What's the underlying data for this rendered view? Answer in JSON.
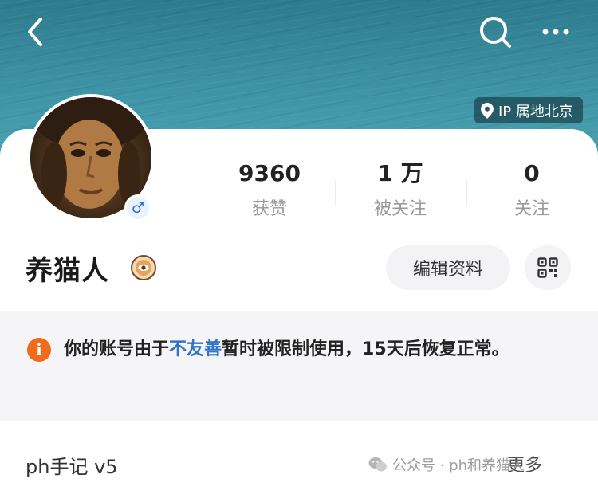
{
  "header": {
    "back_icon": "chevron-left-icon",
    "search_icon": "search-icon",
    "more_icon": "more-horizontal-icon"
  },
  "ip_location": "IP 属地北京",
  "profile": {
    "avatar_icon": "user-avatar",
    "gender_icon": "male-icon",
    "gender_symbol": "♂",
    "username": "养猫人",
    "level_icon": "level-badge-icon"
  },
  "stats": [
    {
      "value": "9360",
      "label": "获赞"
    },
    {
      "value": "1 万",
      "label": "被关注"
    },
    {
      "value": "0",
      "label": "关注"
    }
  ],
  "actions": {
    "edit_label": "编辑资料",
    "qr_icon": "qr-code-icon"
  },
  "notice": {
    "icon": "info-icon",
    "icon_glyph": "i",
    "prefix": "你的账号由于",
    "highlight": "不友善",
    "suffix": "暂时被限制使用，15天后恢复正常。",
    "highlight_color": "#2e74c9",
    "icon_color": "#f06c1c"
  },
  "footer": {
    "title": "ph手记 v5",
    "more_label": "更多",
    "watermark": "公众号 · ph和养猫人"
  }
}
